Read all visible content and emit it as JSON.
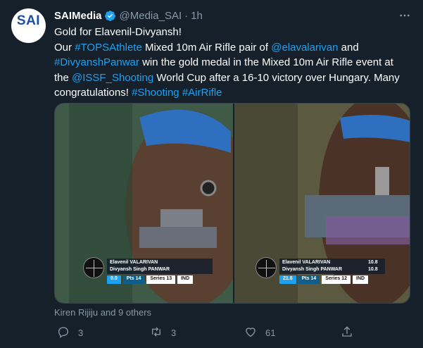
{
  "tweet": {
    "author_name": "SAIMedia",
    "handle": "@Media_SAI",
    "separator": "·",
    "time": "1h",
    "avatar_text": "SAI",
    "lines": [
      [
        {
          "t": "Gold for Elavenil-Divyansh!",
          "link": false
        }
      ],
      [
        {
          "t": "Our ",
          "link": false
        },
        {
          "t": "#TOPSAthlete",
          "link": true
        },
        {
          "t": " Mixed 10m Air Rifle pair of ",
          "link": false
        },
        {
          "t": "@elavalarivan",
          "link": true
        },
        {
          "t": " and",
          "link": false
        }
      ],
      [
        {
          "t": "#DivyanshPanwar",
          "link": true
        },
        {
          "t": " win the gold medal in the Mixed 10m Air Rifle event at",
          "link": false
        }
      ],
      [
        {
          "t": "the ",
          "link": false
        },
        {
          "t": "@ISSF_Shooting",
          "link": true
        },
        {
          "t": " World Cup after a 16-10 victory over Hungary. Many",
          "link": false
        }
      ],
      [
        {
          "t": "congratulations! ",
          "link": false
        },
        {
          "t": "#Shooting",
          "link": true
        },
        {
          "t": " ",
          "link": false
        },
        {
          "t": "#AirRifle",
          "link": true
        }
      ]
    ],
    "liked_by": "Kiren Rijiju and 9 others",
    "reply_count": "3",
    "retweet_count": "3",
    "like_count": "61"
  },
  "media": {
    "left": {
      "name1": "Elavenil VALARIVAN",
      "name2": "Divyansh Singh PANWAR",
      "score": "0.0",
      "pts": "Pts 14",
      "series": "Series 13",
      "country": "IND"
    },
    "right": {
      "name1": "Elavenil VALARIVAN",
      "name2": "Divyansh Singh PANWAR",
      "val1": "10.8",
      "val2": "10.8",
      "score": "21.6",
      "pts": "Pts 14",
      "series": "Series 12",
      "country": "IND"
    }
  },
  "colors": {
    "background": "#15202b",
    "link": "#1da1f2",
    "muted": "#8899a6",
    "verified": "#1da1f2"
  },
  "icons": {
    "verified": "verified-badge-icon",
    "more": "more-dots-icon",
    "reply": "reply-icon",
    "retweet": "retweet-icon",
    "like": "heart-icon",
    "share": "share-icon"
  }
}
